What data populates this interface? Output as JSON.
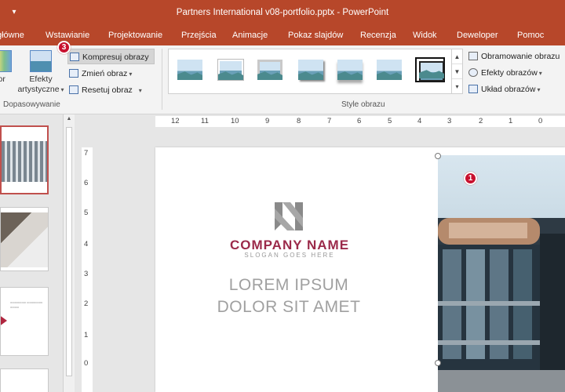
{
  "window": {
    "title": "Partners International v08-portfolio.pptx  -  PowerPoint"
  },
  "tabs": [
    "główne",
    "Wstawianie",
    "Projektowanie",
    "Przejścia",
    "Animacje",
    "Pokaz slajdów",
    "Recenzja",
    "Widok",
    "Deweloper",
    "Pomoc"
  ],
  "ribbon": {
    "adjust": {
      "color_label": "lor",
      "effects_label_line1": "Efekty",
      "effects_label_line2": "artystyczne",
      "compress": "Kompresuj obrazy",
      "change": "Zmień obraz",
      "reset": "Resetuj obraz",
      "group_label": "Dopasowywanie"
    },
    "styles": {
      "group_label": "Style obrazu",
      "border": "Obramowanie obrazu",
      "effects": "Efekty obrazów",
      "layout": "Układ obrazów"
    }
  },
  "badges": {
    "compress": "3",
    "picture": "1"
  },
  "ruler": {
    "horizontal": [
      "12",
      "11",
      "10",
      "9",
      "8",
      "7",
      "6",
      "5",
      "4",
      "3",
      "2",
      "1",
      "0"
    ],
    "vertical": [
      "7",
      "6",
      "5",
      "4",
      "3",
      "2",
      "1",
      "0"
    ]
  },
  "slide": {
    "company": "COMPANY NAME",
    "slogan": "SLOGAN GOES HERE",
    "lorem1": "LOREM IPSUM",
    "lorem2": "DOLOR SIT AMET"
  },
  "thumb_slide3_text": "ooooooooo ooooooooo ooooo"
}
